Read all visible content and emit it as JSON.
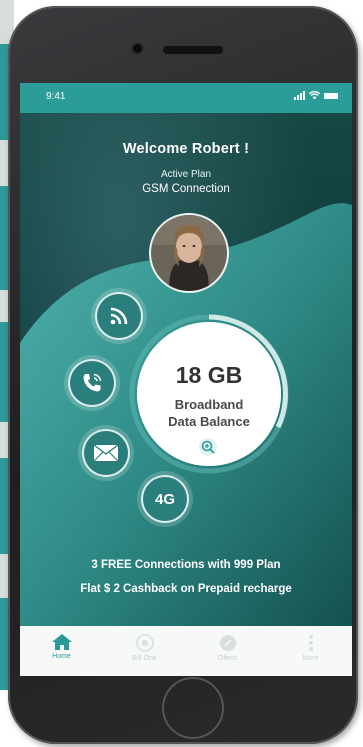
{
  "status_bar": {
    "time": "9:41"
  },
  "header": {
    "welcome": "Welcome Robert !",
    "active_plan_label": "Active Plan",
    "connection": "GSM Connection"
  },
  "balance": {
    "amount": "18 GB",
    "line1": "Broadband",
    "line2": "Data Balance"
  },
  "side_buttons": {
    "network_badge": "4G"
  },
  "promos": [
    "3 FREE Connections with 999 Plan",
    "Flat $ 2 Cashback on Prepaid recharge"
  ],
  "tabbar": {
    "items": [
      {
        "label": "Home",
        "icon": "home-icon",
        "active": true
      },
      {
        "label": "Bill One",
        "icon": "bill-icon",
        "active": false
      },
      {
        "label": "Offers",
        "icon": "offers-icon",
        "active": false
      },
      {
        "label": "More",
        "icon": "more-icon",
        "active": false
      }
    ]
  },
  "colors": {
    "accent": "#2c9c99",
    "dark_teal": "#0f4a47",
    "phone_frame": "#2a2a2c"
  }
}
